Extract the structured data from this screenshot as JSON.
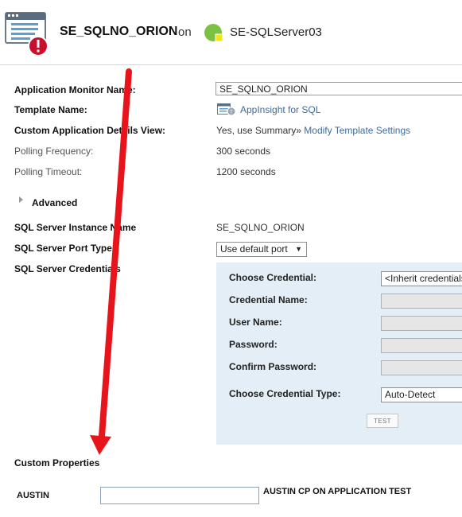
{
  "header": {
    "title": "SE_SQLNO_ORION",
    "on_text": "on",
    "server": "SE-SQLServer03"
  },
  "fields": {
    "app_monitor_name": {
      "label": "Application Monitor Name:",
      "value": "SE_SQLNO_ORION"
    },
    "template_name": {
      "label": "Template Name:",
      "link": "AppInsight for SQL"
    },
    "custom_view": {
      "label": "Custom Application Details View:",
      "text": "Yes, use Summary»",
      "link": "Modify Template Settings"
    },
    "polling_frequency": {
      "label": "Polling Frequency:",
      "value": "300 seconds"
    },
    "polling_timeout": {
      "label": "Polling Timeout:",
      "value": "1200 seconds"
    }
  },
  "advanced": {
    "label": "Advanced"
  },
  "sql": {
    "instance_name": {
      "label": "SQL Server Instance Name",
      "value": "SE_SQLNO_ORION"
    },
    "port_type": {
      "label": "SQL Server Port Type",
      "selected": "Use default port"
    },
    "credentials": {
      "label": "SQL Server Credentials"
    }
  },
  "credential_panel": {
    "choose_credential": {
      "label": "Choose Credential:",
      "value": "<Inherit credentials from template>"
    },
    "credential_name": {
      "label": "Credential Name:",
      "value": ""
    },
    "user_name": {
      "label": "User Name:",
      "value": ""
    },
    "password": {
      "label": "Password:",
      "value": ""
    },
    "confirm_password": {
      "label": "Confirm Password:",
      "value": ""
    },
    "credential_type": {
      "label": "Choose Credential Type:",
      "value": "Auto-Detect"
    },
    "test_button": "TEST"
  },
  "custom_properties": {
    "title": "Custom Properties",
    "items": [
      {
        "name": "AUSTIN",
        "value": "",
        "description": "AUSTIN CP ON APPLICATION TEST"
      }
    ]
  },
  "colors": {
    "link": "#3f6b9e",
    "panel_bg": "#e4eef6",
    "annotation_arrow": "#e8141c",
    "alert_badge": "#c8102e",
    "server_status": "#7cc242"
  }
}
